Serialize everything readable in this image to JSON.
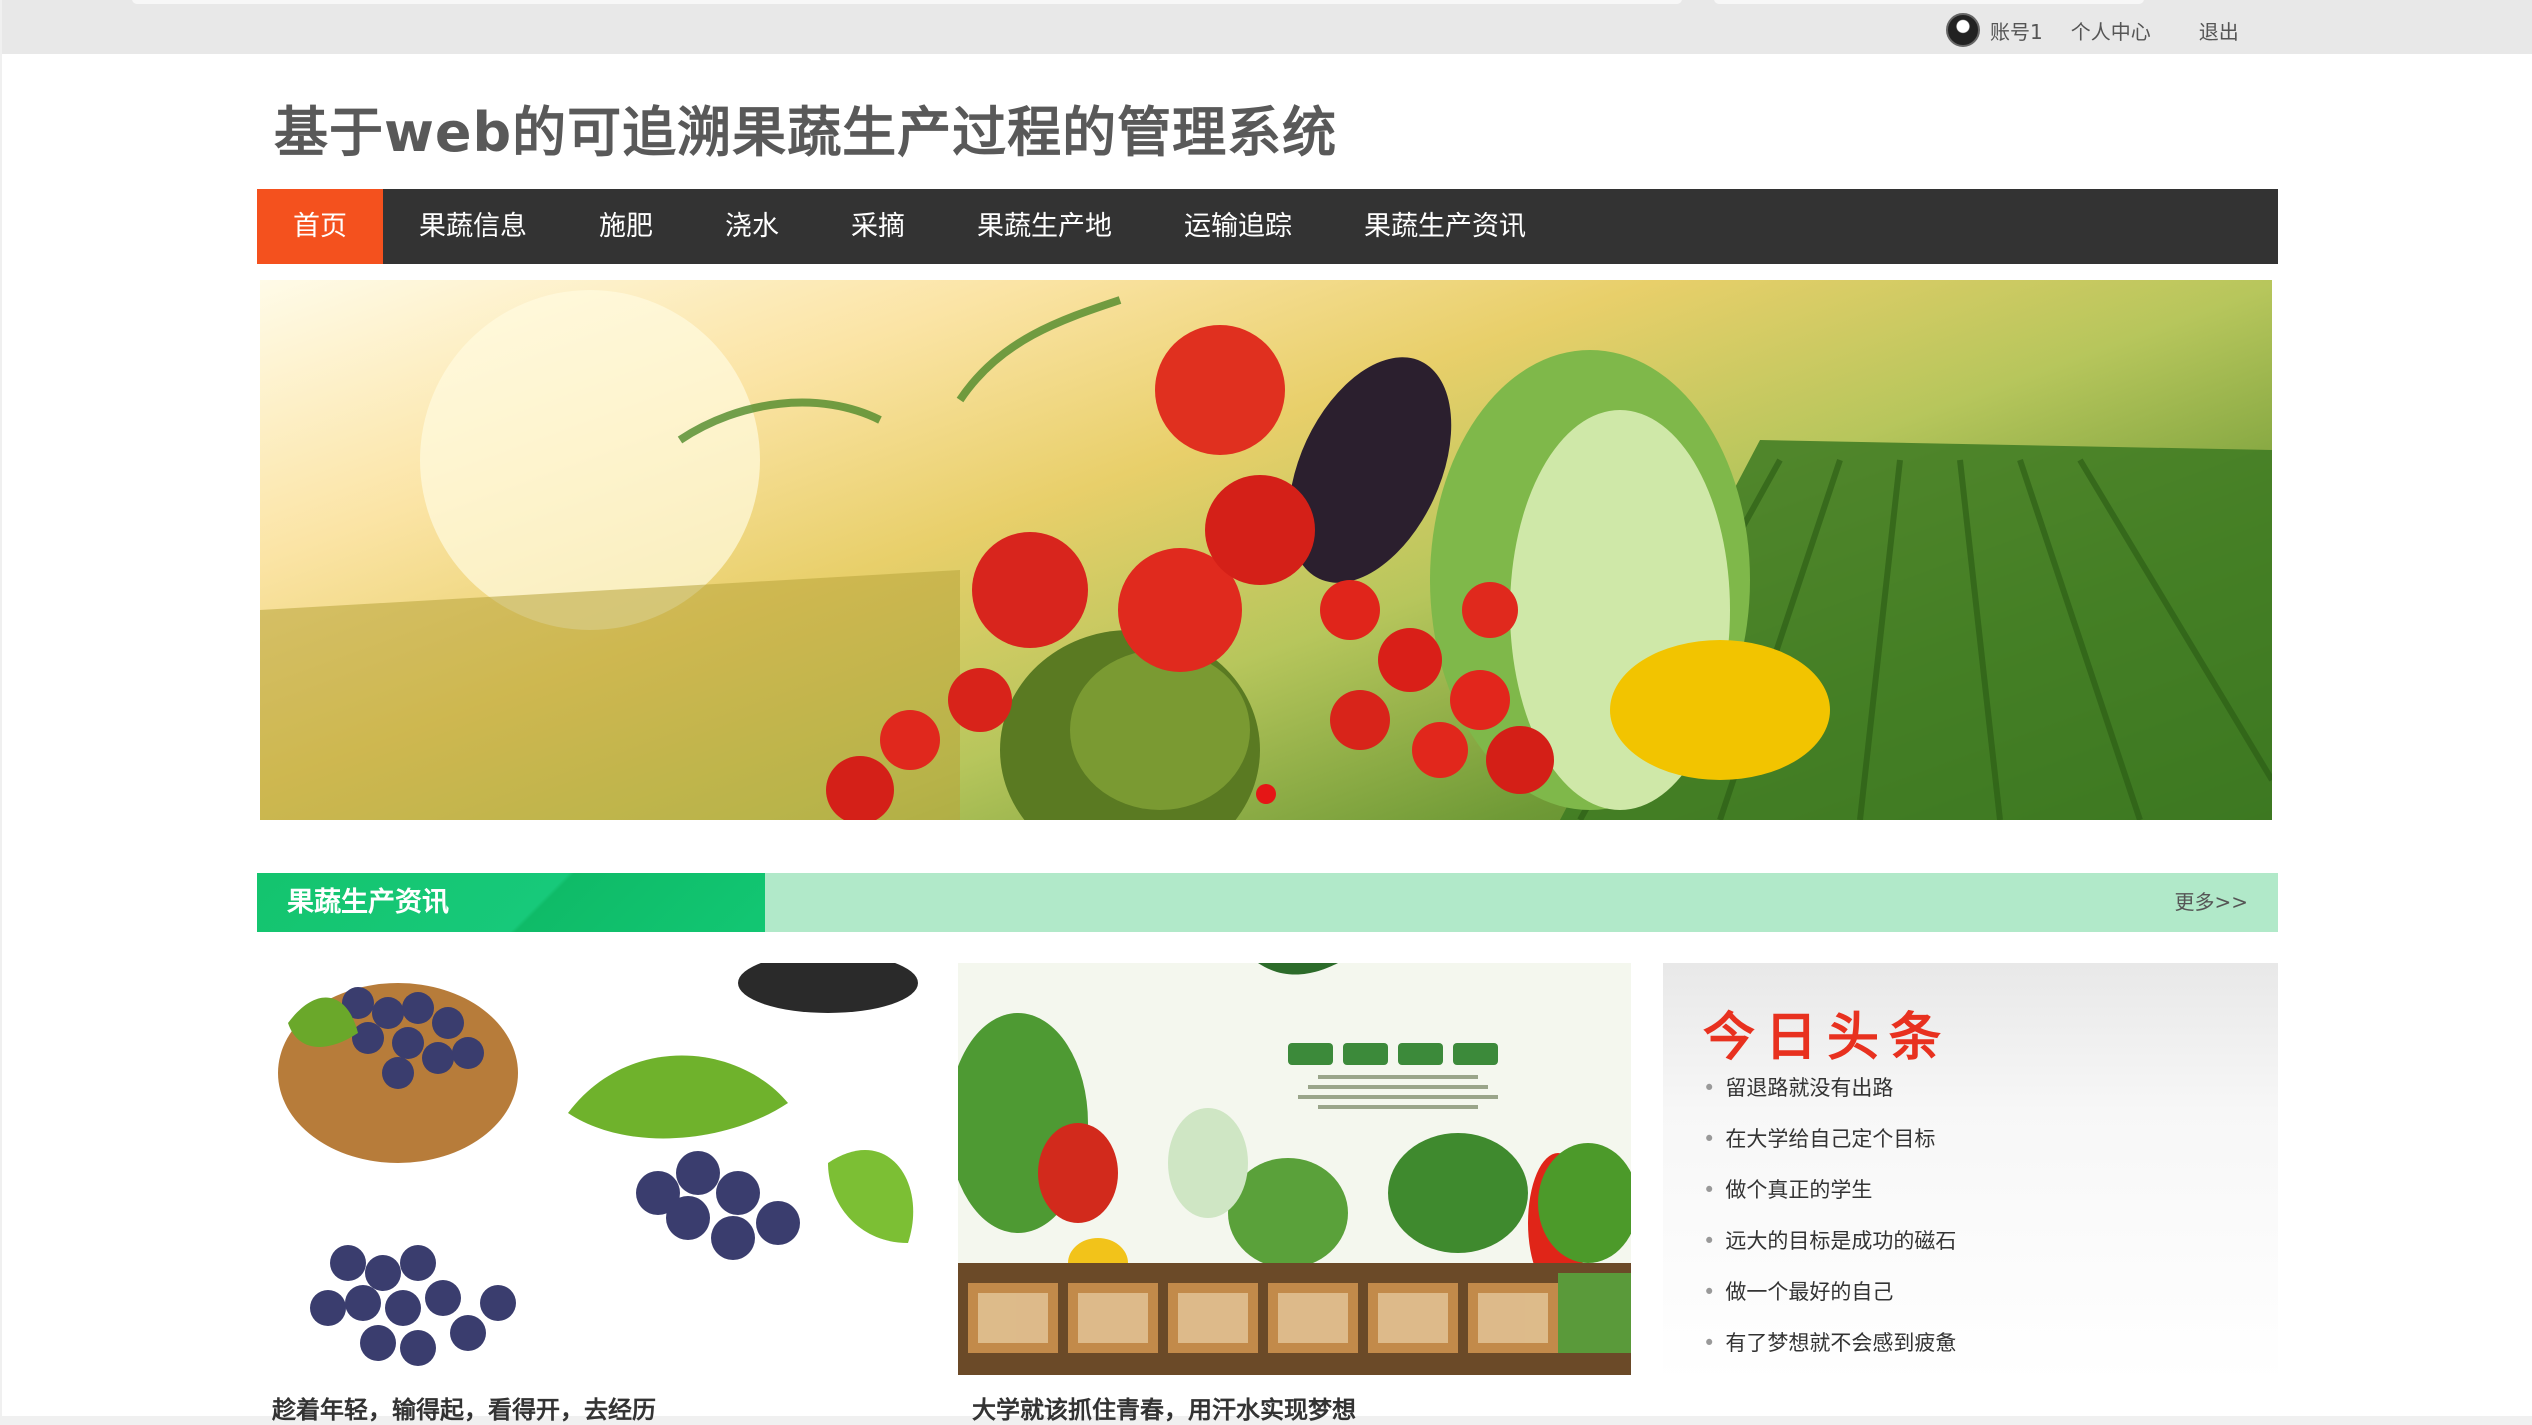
{
  "topbar": {
    "account_label": "账号1",
    "profile_label": "个人中心",
    "logout_label": "退出"
  },
  "site": {
    "title": "基于web的可追溯果蔬生产过程的管理系统"
  },
  "nav": {
    "items": [
      {
        "label": "首页",
        "active": true
      },
      {
        "label": "果蔬信息"
      },
      {
        "label": "施肥"
      },
      {
        "label": "浇水"
      },
      {
        "label": "采摘"
      },
      {
        "label": "果蔬生产地"
      },
      {
        "label": "运输追踪"
      },
      {
        "label": "果蔬生产资讯"
      }
    ]
  },
  "colors": {
    "nav_bg": "#333333",
    "nav_active": "#f4511e",
    "section_green": "#14c46e",
    "section_band": "#b1e9c9",
    "headline_red": "#e8311f"
  },
  "news": {
    "section_title": "果蔬生产资讯",
    "more_label": "更多>>",
    "cards": [
      {
        "caption": "趁着年轻，输得起，看得开，去经历"
      },
      {
        "caption": "大学就该抓住青春，用汗水实现梦想"
      }
    ]
  },
  "headlines": {
    "title": "今日头条",
    "items": [
      "留退路就没有出路",
      "在大学给自己定个目标",
      "做个真正的学生",
      "远大的目标是成功的磁石",
      "做一个最好的自己",
      "有了梦想就不会感到疲惫"
    ]
  }
}
